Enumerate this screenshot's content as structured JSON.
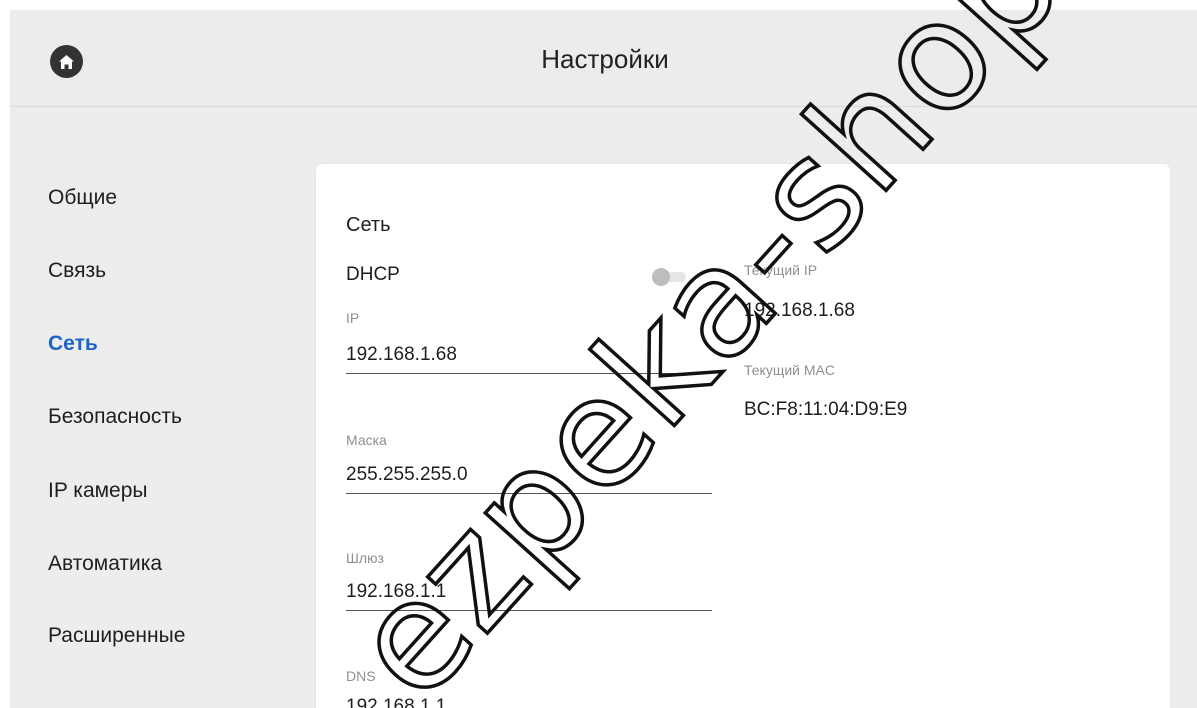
{
  "header": {
    "title": "Настройки",
    "home_icon": "home-icon"
  },
  "sidebar": {
    "items": [
      {
        "label": "Общие",
        "active": false
      },
      {
        "label": "Связь",
        "active": false
      },
      {
        "label": "Сеть",
        "active": true
      },
      {
        "label": "Безопасность",
        "active": false
      },
      {
        "label": "IP камеры",
        "active": false
      },
      {
        "label": "Автоматика",
        "active": false
      },
      {
        "label": "Расширенные",
        "active": false
      }
    ]
  },
  "network": {
    "section_title": "Сеть",
    "dhcp": {
      "label": "DHCP",
      "enabled": false
    },
    "fields": {
      "ip": {
        "label": "IP",
        "value": "192.168.1.68"
      },
      "mask": {
        "label": "Маска",
        "value": "255.255.255.0"
      },
      "gateway": {
        "label": "Шлюз",
        "value": "192.168.1.1"
      },
      "dns": {
        "label": "DNS",
        "value": "192.168.1.1"
      }
    },
    "current_ip": {
      "label": "Текущий IP",
      "value": "192.168.1.68"
    },
    "current_mac": {
      "label": "Текущий MAC",
      "value": "BC:F8:11:04:D9:E9"
    }
  },
  "watermark": {
    "text": "ezpeka-shop.com"
  },
  "colors": {
    "accent": "#1e63c6",
    "background": "#ededed",
    "panel": "#ffffff",
    "text": "#1e1e1e",
    "muted": "#8f8f8f"
  }
}
